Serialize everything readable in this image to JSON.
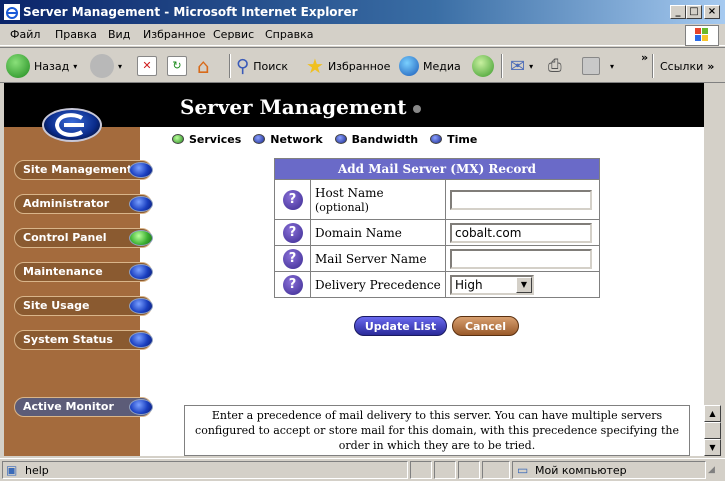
{
  "window": {
    "title": "Server Management - Microsoft Internet Explorer",
    "minimize": "_",
    "maximize": "□",
    "close": "×"
  },
  "menu": [
    "Файл",
    "Правка",
    "Вид",
    "Избранное",
    "Сервис",
    "Справка"
  ],
  "toolbar": {
    "back": "Назад",
    "search": "Поиск",
    "favorites": "Избранное",
    "media": "Медиа",
    "links": "Ссылки",
    "chevron": "»"
  },
  "page": {
    "header_title": "Server Management",
    "sidebar": [
      {
        "label": "Site Management",
        "status": "blue"
      },
      {
        "label": "Administrator",
        "status": "blue"
      },
      {
        "label": "Control Panel",
        "status": "green"
      },
      {
        "label": "Maintenance",
        "status": "blue"
      },
      {
        "label": "Site Usage",
        "status": "blue"
      },
      {
        "label": "System Status",
        "status": "blue"
      },
      {
        "label": "Active Monitor",
        "status": "blue"
      }
    ],
    "tabs": [
      {
        "label": "Services",
        "active": true
      },
      {
        "label": "Network",
        "active": false
      },
      {
        "label": "Bandwidth",
        "active": false
      },
      {
        "label": "Time",
        "active": false
      }
    ],
    "form": {
      "title": "Add Mail Server (MX) Record",
      "host_name_label": "Host Name",
      "host_name_sublabel": "(optional)",
      "host_name_value": "",
      "domain_name_label": "Domain Name",
      "domain_name_value": "cobalt.com",
      "mail_server_label": "Mail Server Name",
      "mail_server_value": "",
      "precedence_label": "Delivery Precedence",
      "precedence_value": "High",
      "help_glyph": "?"
    },
    "buttons": {
      "update": "Update List",
      "cancel": "Cancel"
    },
    "help_text": "Enter a precedence of mail delivery to this server. You can have multiple servers configured to accept or store mail for this domain, with this precedence specifying the order in which they are to be tried."
  },
  "status": {
    "text": "help",
    "zone": "Мой компьютер"
  }
}
